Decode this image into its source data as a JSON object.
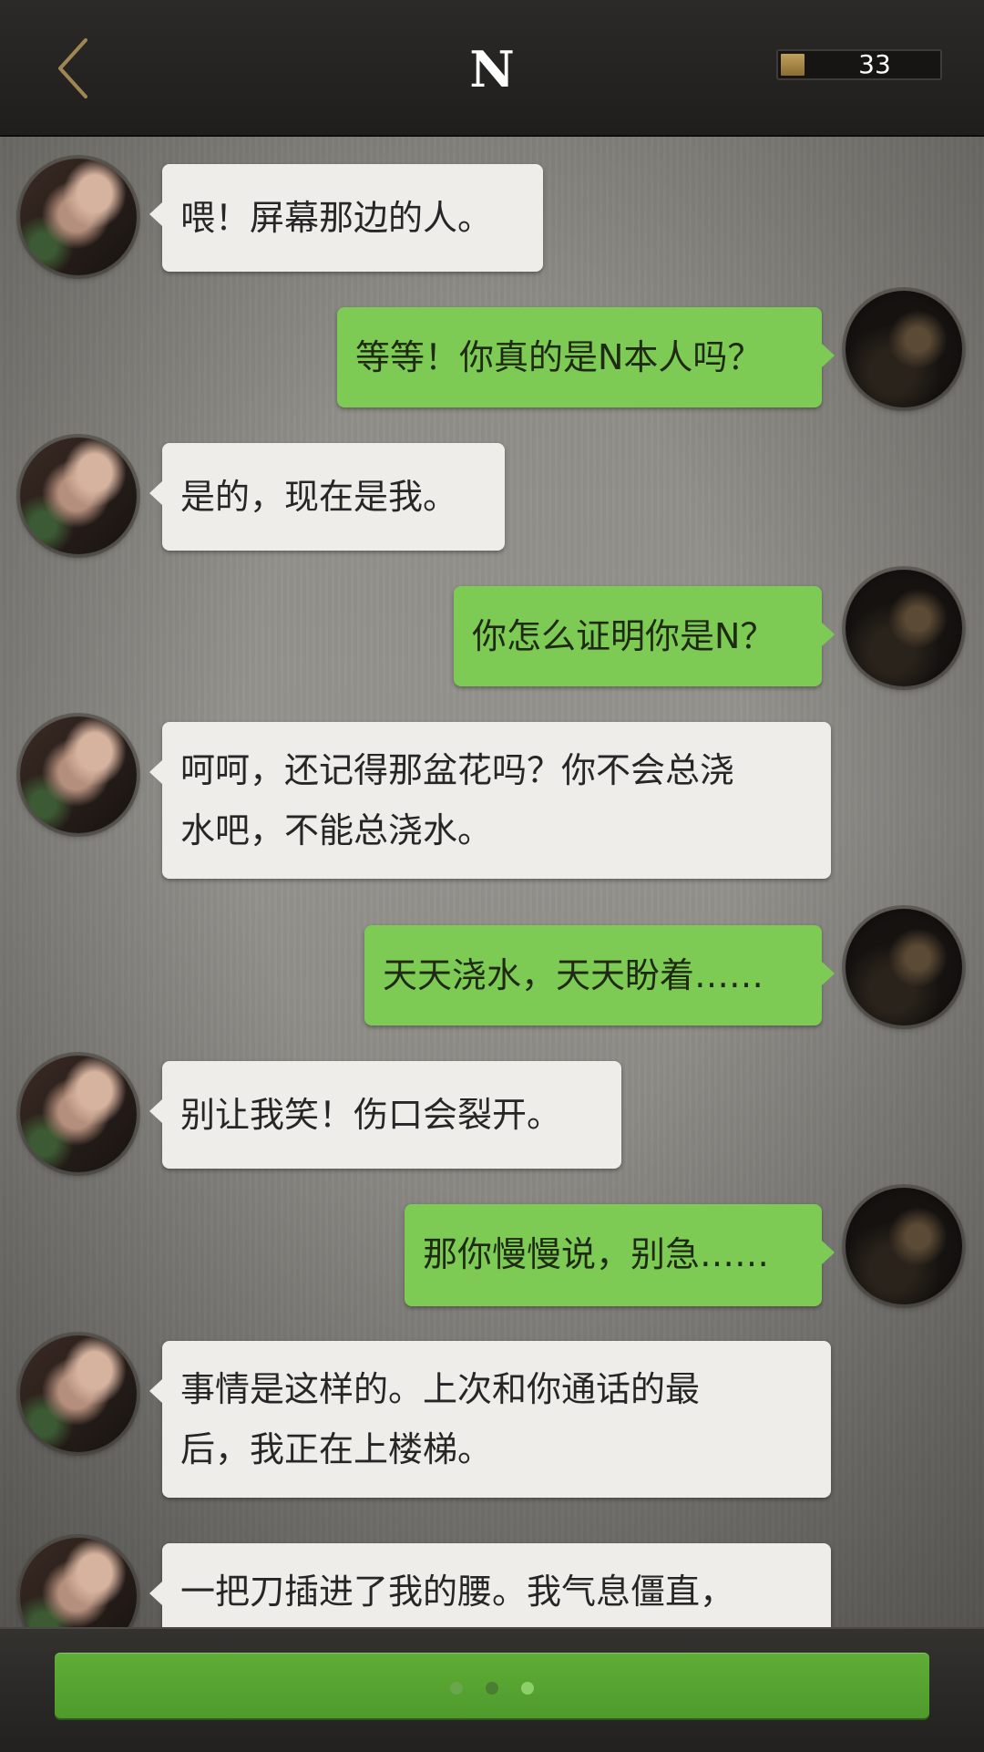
{
  "header": {
    "back_icon": "chevron-left-icon",
    "title": "N",
    "counter_value": "33"
  },
  "colors": {
    "accent_green": "#7dcb55",
    "incoming_bubble": "#eeede9",
    "back_chevron": "#a08652"
  },
  "messages": [
    {
      "sender": "N",
      "lines": [
        "喂！屏幕那边的人。"
      ]
    },
    {
      "sender": "me",
      "lines": [
        "等等！你真的是N本人吗？"
      ]
    },
    {
      "sender": "N",
      "lines": [
        "是的，现在是我。"
      ]
    },
    {
      "sender": "me",
      "lines": [
        "你怎么证明你是N？"
      ]
    },
    {
      "sender": "N",
      "lines": [
        "呵呵，还记得那盆花吗？你不会总浇",
        "水吧，不能总浇水。"
      ]
    },
    {
      "sender": "me",
      "lines": [
        "天天浇水，天天盼着……"
      ]
    },
    {
      "sender": "N",
      "lines": [
        "别让我笑！伤口会裂开。"
      ]
    },
    {
      "sender": "me",
      "lines": [
        "那你慢慢说，别急……"
      ]
    },
    {
      "sender": "N",
      "lines": [
        "事情是这样的。上次和你通话的最",
        "后，我正在上楼梯。"
      ]
    },
    {
      "sender": "N",
      "lines": [
        "一把刀插进了我的腰。我气息僵直，"
      ]
    }
  ],
  "footer": {
    "typing_indicator_dots": 3
  }
}
